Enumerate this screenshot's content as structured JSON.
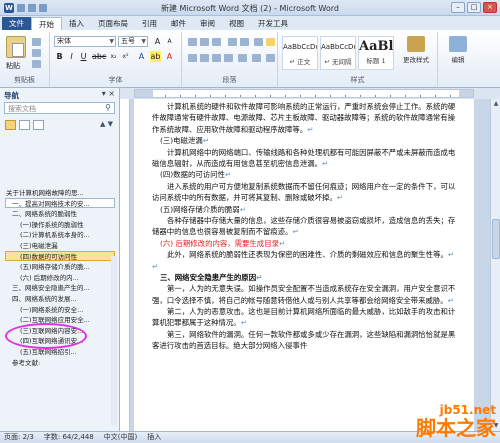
{
  "app": {
    "title": "新建 Microsoft Word 文档 (2) - Microsoft Word"
  },
  "tabs": [
    "文件",
    "开始",
    "插入",
    "页面布局",
    "引用",
    "邮件",
    "审阅",
    "视图",
    "开发工具"
  ],
  "ribbon": {
    "paste_label": "粘贴",
    "clipboard_label": "剪贴板",
    "font_name": "宋体",
    "font_size": "五号",
    "font_label": "字体",
    "paragraph_label": "段落",
    "styles_label": "样式",
    "styles": [
      {
        "sample": "AaBbCcDd",
        "name": "↵ 正文"
      },
      {
        "sample": "AaBbCcDd",
        "name": "↵ 无间隔"
      },
      {
        "sample": "AaBl",
        "name": "标题 1"
      }
    ],
    "change_styles": "更改样式",
    "edit_label": "编辑"
  },
  "nav": {
    "title": "导航",
    "search_placeholder": "搜索文档",
    "items": [
      {
        "text": "关于计算机网络故障的思...",
        "level": 1
      },
      {
        "text": "一、提高对网络技术的安...",
        "level": 2
      },
      {
        "text": "二、网络系统的脆弱性",
        "level": 2
      },
      {
        "text": "(一)操作系统的脆弱性",
        "level": 3
      },
      {
        "text": "(二)计算机系统本身的...",
        "level": 3
      },
      {
        "text": "(三)电磁泄漏",
        "level": 3
      },
      {
        "text": "(四)数据的可访问性",
        "level": 3
      },
      {
        "text": "(五)网络存储介质的脆...",
        "level": 3
      },
      {
        "text": "(六) 后期修改的内...",
        "level": 3
      },
      {
        "text": "三、网络安全隐患产生的...",
        "level": 2
      },
      {
        "text": "四、网络系统的发展...",
        "level": 2
      },
      {
        "text": "(一)网络系统的安全...",
        "level": 3
      },
      {
        "text": "(二)互联网络应用安全...",
        "level": 3
      },
      {
        "text": "(三)互联网络内容安...",
        "level": 3
      },
      {
        "text": "(四)互联网络通讯安...",
        "level": 3
      },
      {
        "text": "(五)互联网络招引...",
        "level": 3
      },
      {
        "text": "参考文献:",
        "level": 2
      }
    ]
  },
  "document": {
    "paragraphs": [
      {
        "type": "indent",
        "text": "计算机系统的硬件和软件故障可影响系统的正常运行，严重时系统会停止工作。系统的硬件故障通常有硬件故障、电源故障、芯片主板故障、驱动器故障等；系统的软件故障通常有操作系统故障、应用软件故障和驱动程序故障等。"
      },
      {
        "type": "head",
        "text": "(三)电磁泄漏"
      },
      {
        "type": "indent",
        "text": "计算机网络中的网络端口、传输线路和各种处理机都有可能因屏蔽不严或未屏蔽而造成电磁信息辐射，从而造成有用信息甚至机密信息泄漏。"
      },
      {
        "type": "head",
        "text": "(四)数据的可访问性"
      },
      {
        "type": "indent",
        "text": "进入系统的用户可方便地复制系统数据而不留任何痕迹；网络用户在一定的条件下，可以访问系统中的所有数据，并可将其复制、删除或破坏掉。"
      },
      {
        "type": "head",
        "text": "(五)网络存储介质的脆弱"
      },
      {
        "type": "indent",
        "text": "各种存储器中存储大量的信息，这些存储介质很容易被盗窃或损坏，造成信息的丢失；存储器中的信息也很容易被复制而不留痕迹。"
      },
      {
        "type": "red",
        "text": "(六) 后期修改的内容，需要生成目录"
      },
      {
        "type": "indent",
        "text": "此外，网络系统的脆弱性还表现为保密的困难性、介质的剩磁效应和信息的聚生性等。"
      },
      {
        "type": "blank",
        "text": ""
      },
      {
        "type": "bold",
        "text": "三、网络安全隐患产生的原因"
      },
      {
        "type": "indent",
        "text": "第一，人为的无意失误。如操作员安全配置不当造成系统存在安全漏洞，用户安全意识不强，口令选择不慎，将自己的帐号随意转借他人或与别人共享等都会给网络安全带来威胁。"
      },
      {
        "type": "indent",
        "text": "第二，人为的恶意攻击。这也是目前计算机网络所面临的最大威胁，比如敌手的攻击和计算机犯罪都属于这种情况。"
      },
      {
        "type": "indent",
        "text": "第三，网络软件的漏洞。任何一款软件都或多或少存在漏洞，这些缺陷和漏洞恰恰就是黑客进行攻击的首选目标。绝大部分网络入侵事件"
      }
    ]
  },
  "status": {
    "page": "页面: 2/3",
    "words": "字数: 64/2,448",
    "lang": "中文(中国)",
    "mode": "插入"
  },
  "watermark": {
    "url": "jb51.net",
    "cn": "脚本之家"
  }
}
